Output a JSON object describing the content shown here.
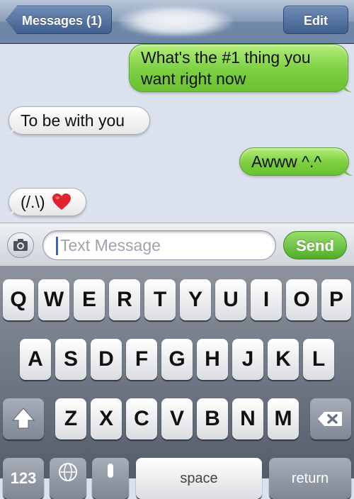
{
  "nav": {
    "back_label": "Messages (1)",
    "contact_name": "",
    "edit_label": "Edit"
  },
  "messages": [
    {
      "side": "sent",
      "line1": "What's the #1 thing you",
      "line2": "want right now"
    },
    {
      "side": "received",
      "text": "To be with you"
    },
    {
      "side": "sent",
      "text": "Awww ^.^"
    },
    {
      "side": "received",
      "text": "(/.\\)",
      "emoji": "heart"
    }
  ],
  "composer": {
    "placeholder": "Text Message",
    "send_label": "Send",
    "camera_icon": "camera-icon"
  },
  "keyboard": {
    "row1": [
      "Q",
      "W",
      "E",
      "R",
      "T",
      "Y",
      "U",
      "I",
      "O",
      "P"
    ],
    "row2": [
      "A",
      "S",
      "D",
      "F",
      "G",
      "H",
      "J",
      "K",
      "L"
    ],
    "row3": [
      "Z",
      "X",
      "C",
      "V",
      "B",
      "N",
      "M"
    ],
    "shift_icon": "shift-icon",
    "delete_icon": "delete-icon",
    "numbers_label": "123",
    "globe_icon": "globe-icon",
    "mic_icon": "microphone-icon",
    "space_label": "space",
    "return_label": "return"
  },
  "colors": {
    "sent_bubble": "#7bcf40",
    "received_bubble": "#ffffff",
    "nav_button": "#4f6f9f",
    "send_button": "#4fae2a"
  }
}
